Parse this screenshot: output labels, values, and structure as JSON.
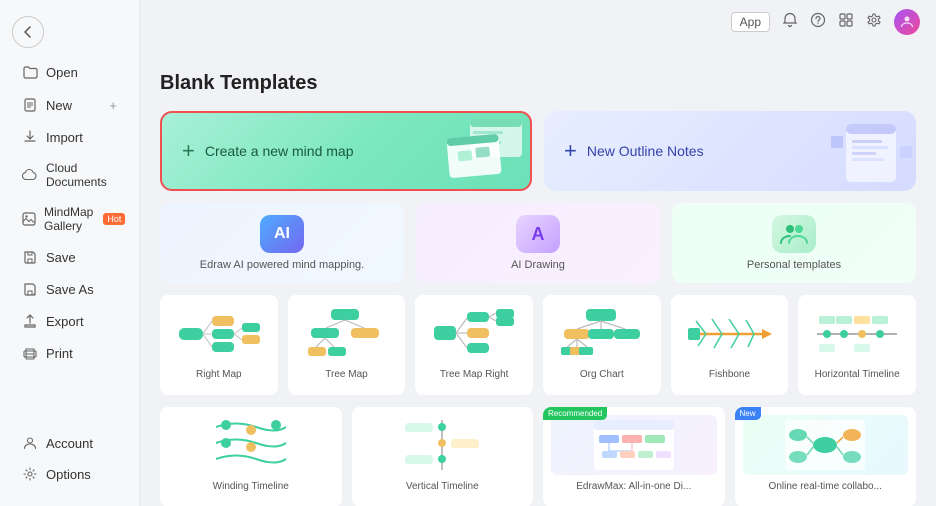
{
  "app": {
    "title": "Blank Templates",
    "topbar": {
      "app_btn": "App",
      "bell_icon": "bell",
      "question_icon": "question",
      "grid_icon": "grid",
      "settings_icon": "settings"
    }
  },
  "sidebar": {
    "back_label": "←",
    "items": [
      {
        "id": "open",
        "label": "Open",
        "icon": "folder"
      },
      {
        "id": "new",
        "label": "New",
        "icon": "file",
        "has_plus": true
      },
      {
        "id": "import",
        "label": "Import",
        "icon": "import"
      },
      {
        "id": "cloud",
        "label": "Cloud Documents",
        "icon": "cloud"
      },
      {
        "id": "gallery",
        "label": "MindMap Gallery",
        "icon": "image",
        "badge": "Hot"
      },
      {
        "id": "save",
        "label": "Save",
        "icon": "save"
      },
      {
        "id": "saveas",
        "label": "Save As",
        "icon": "saveas"
      },
      {
        "id": "export",
        "label": "Export",
        "icon": "export"
      },
      {
        "id": "print",
        "label": "Print",
        "icon": "print"
      }
    ],
    "bottom_items": [
      {
        "id": "account",
        "label": "Account",
        "icon": "account"
      },
      {
        "id": "options",
        "label": "Options",
        "icon": "options"
      }
    ]
  },
  "hero_cards": {
    "create": {
      "label": "Create a new mind map",
      "plus": "+"
    },
    "outline": {
      "label": "New Outline Notes",
      "plus": "+"
    }
  },
  "feature_cards": [
    {
      "id": "edraw-ai",
      "label": "Edraw AI powered mind mapping.",
      "icon_text": "AI"
    },
    {
      "id": "ai-drawing",
      "label": "AI Drawing",
      "icon_text": "A"
    },
    {
      "id": "personal",
      "label": "Personal templates",
      "icon_text": "👥"
    }
  ],
  "template_cards": [
    {
      "id": "right-map",
      "label": "Right Map"
    },
    {
      "id": "tree-map",
      "label": "Tree Map"
    },
    {
      "id": "tree-map-right",
      "label": "Tree Map Right"
    },
    {
      "id": "org-chart",
      "label": "Org Chart"
    },
    {
      "id": "fishbone",
      "label": "Fishbone"
    },
    {
      "id": "horizontal-timeline",
      "label": "Horizontal Timeline"
    }
  ],
  "bottom_cards": [
    {
      "id": "winding-timeline",
      "label": "Winding Timeline",
      "badge": null
    },
    {
      "id": "vertical-timeline",
      "label": "Vertical Timeline",
      "badge": null
    },
    {
      "id": "edrawmax-allinone",
      "label": "EdrawMax: All-in-one Di...",
      "badge": "Recommended"
    },
    {
      "id": "online-realtime",
      "label": "Online real-time collabo...",
      "badge": "New"
    }
  ]
}
